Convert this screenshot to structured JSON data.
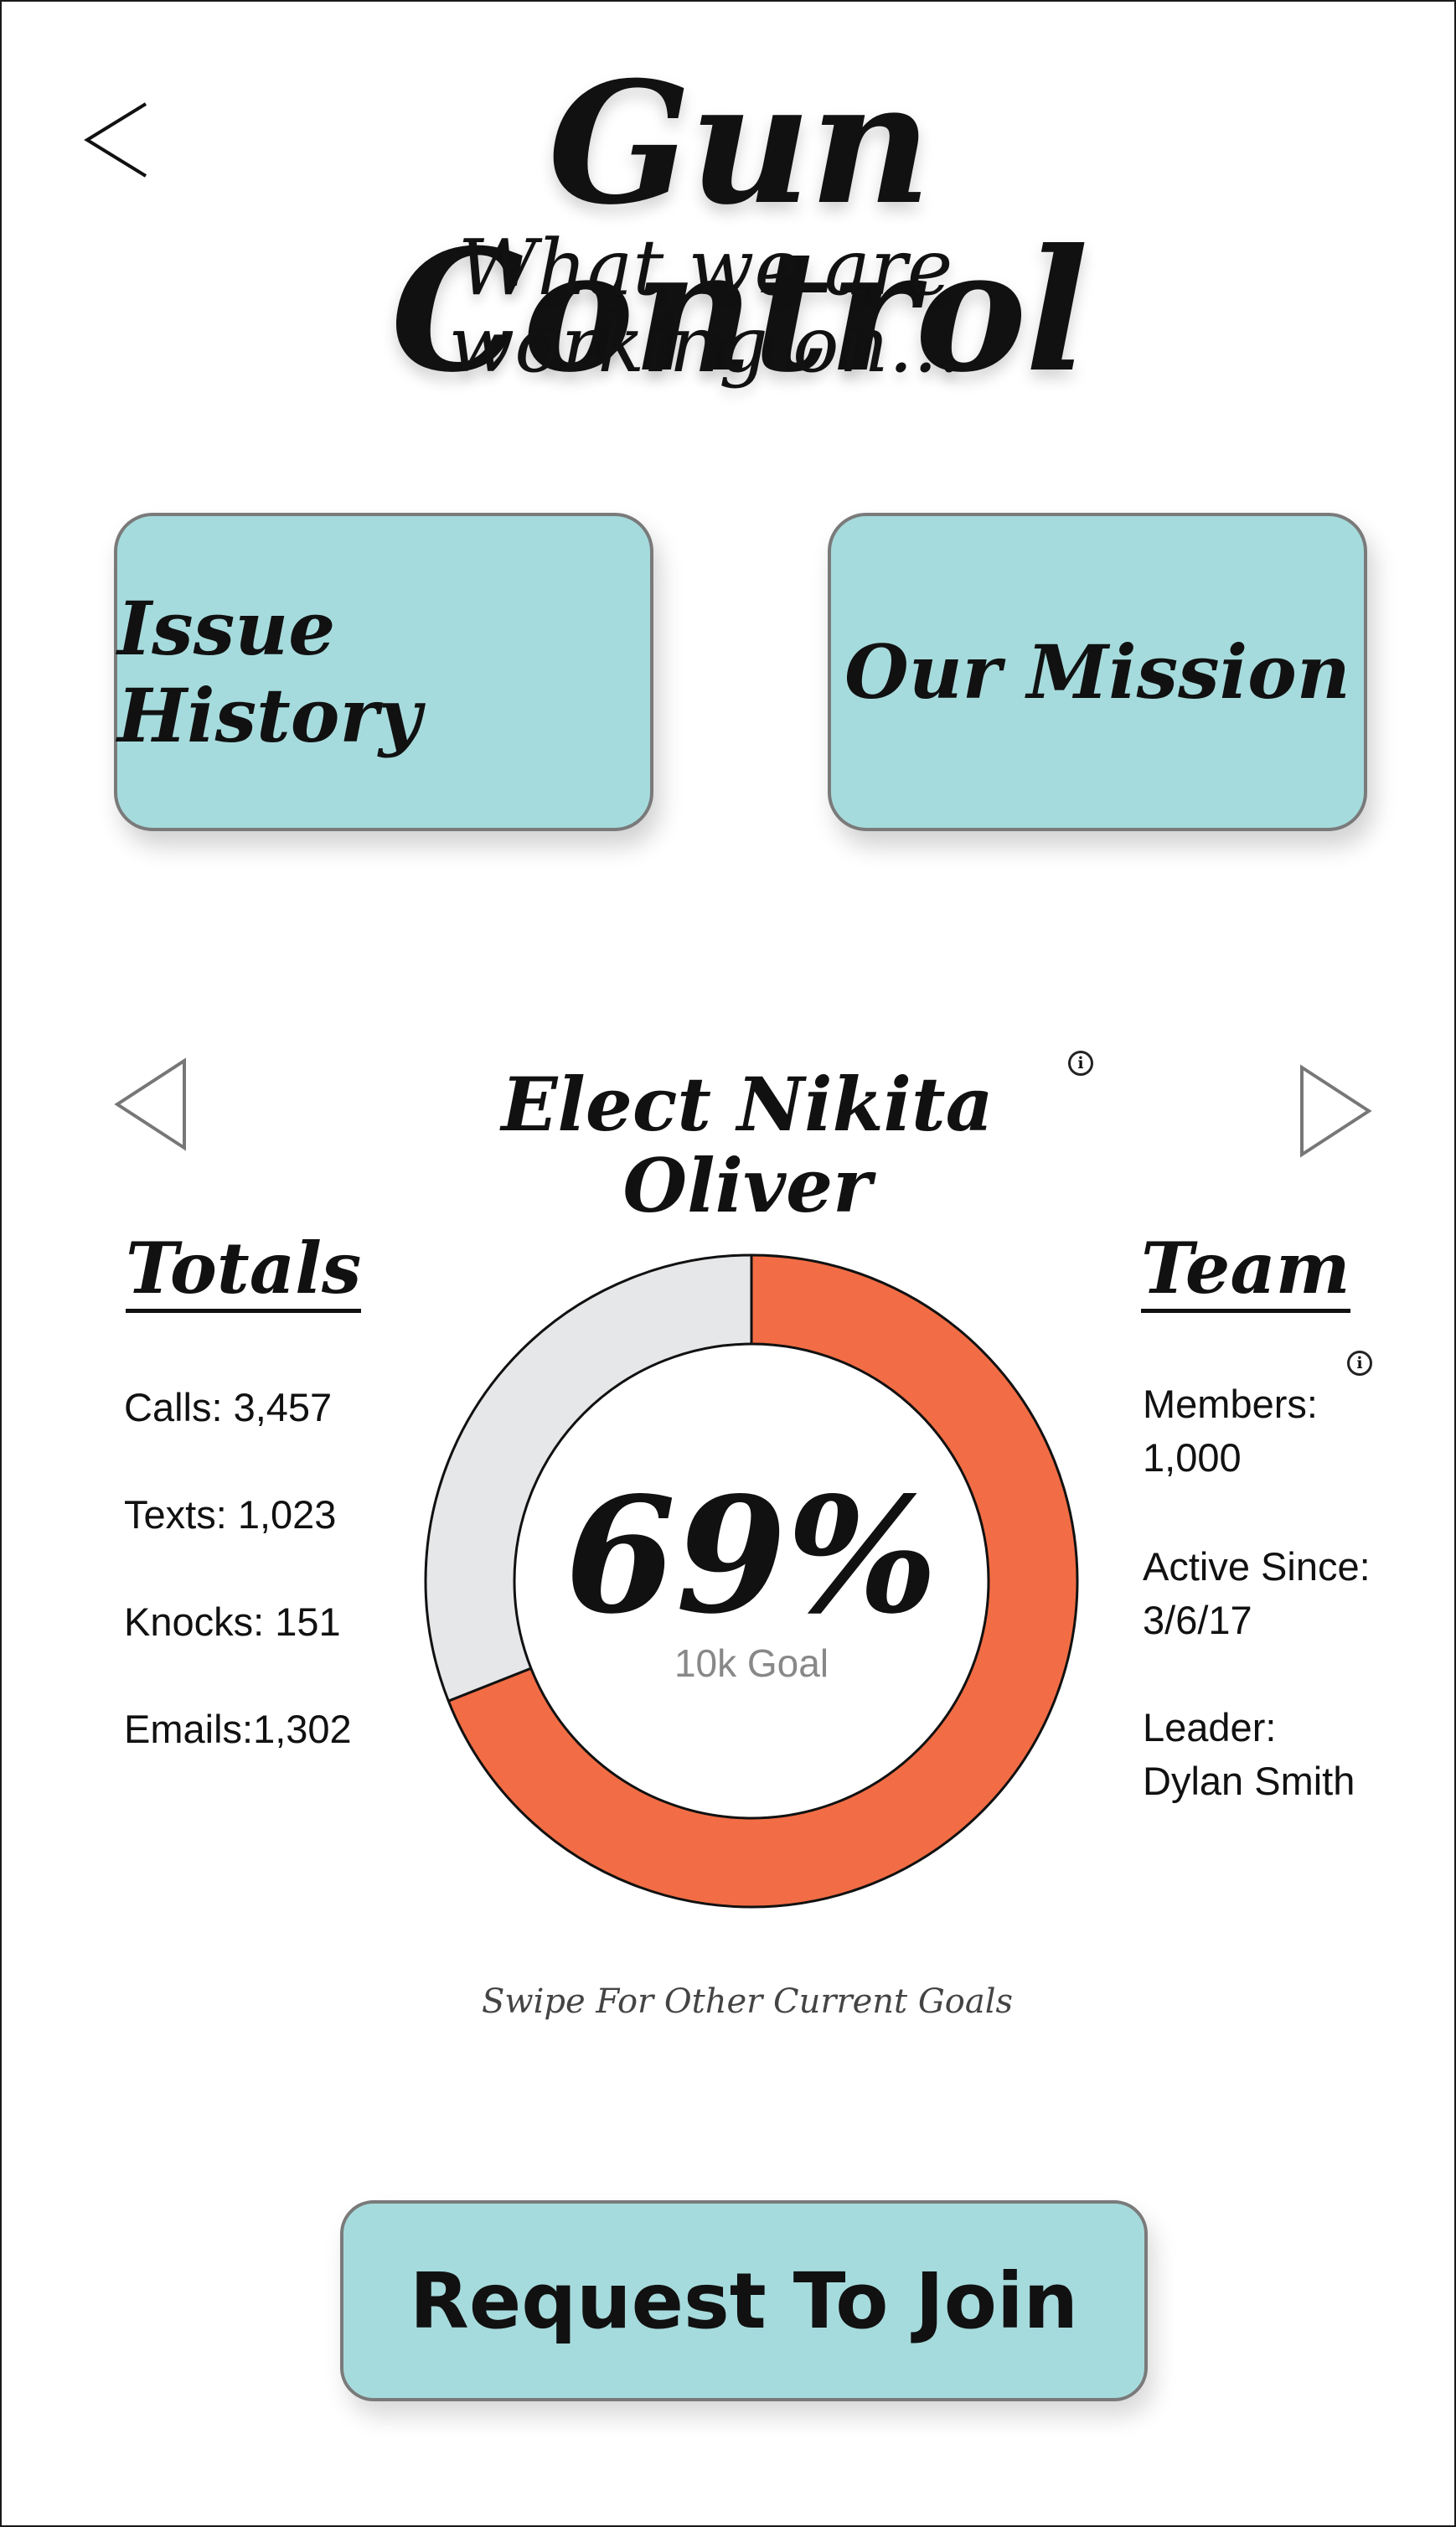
{
  "header": {
    "title": "Gun Control",
    "subtitle": "What we are working on..."
  },
  "tiles": {
    "issue_history": "Issue History",
    "our_mission": "Our Mission"
  },
  "goal": {
    "title": "Elect Nikita Oliver",
    "info_glyph": "i",
    "percent_label": "69%",
    "progress": 0.69,
    "goal_label": "10k Goal",
    "swipe_hint": "Swipe For Other Current Goals"
  },
  "totals": {
    "heading": "Totals",
    "calls": "Calls: 3,457",
    "texts": "Texts: 1,023",
    "knocks": "Knocks: 151",
    "emails": "Emails:1,302"
  },
  "team": {
    "heading": "Team",
    "info_glyph": "i",
    "members_label": "Members:",
    "members_value": "1,000",
    "active_label": "Active Since:",
    "active_value": "3/6/17",
    "leader_label": "Leader:",
    "leader_value": "Dylan Smith"
  },
  "cta": {
    "label": "Request To Join"
  },
  "colors": {
    "tile_bg": "#a6dbdd",
    "progress_fill": "#f26d45",
    "progress_track": "#e6e7e8"
  }
}
